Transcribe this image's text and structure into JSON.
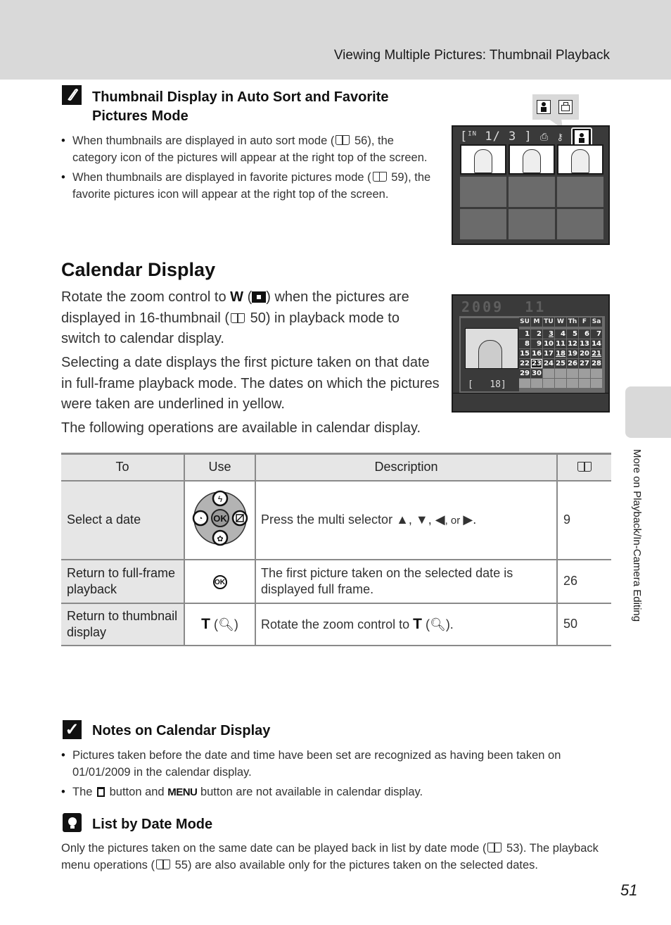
{
  "header": {
    "title": "Viewing Multiple Pictures: Thumbnail Playback"
  },
  "side_tab": {
    "label": "More on Playback/In-Camera Editing"
  },
  "page_number": "51",
  "thumbnail_note": {
    "icon": "pencil-note-icon",
    "title_line1": "Thumbnail Display in Auto Sort and Favorite",
    "title_line2": "Pictures Mode",
    "bullets": [
      {
        "pre": "When thumbnails are displayed in auto sort mode (",
        "ref": "56",
        "post": "), the category icon of the pictures will appear at the right top of the screen."
      },
      {
        "pre": "When thumbnails are displayed in favorite pictures mode (",
        "ref": "59",
        "post": "), the favorite pictures icon will appear at the right top of the screen."
      }
    ]
  },
  "thumb_screen": {
    "memory": "IN",
    "frame_status": "1/ 3",
    "callout_icons": [
      "portrait-category-icon",
      "museum-bag-category-icon"
    ],
    "highlight_icon": "portrait-category-icon",
    "photo_count": 3,
    "empty_count": 6
  },
  "calendar_section": {
    "title": "Calendar Display",
    "para1_pre": "Rotate the zoom control to ",
    "para1_w": "W",
    "para1_mid": ") when the pictures are displayed in 16-thumbnail (",
    "para1_ref": "50",
    "para1_post": ") in playback mode to switch to calendar display.",
    "para2": "Selecting a date displays the first picture taken on that date in full-frame playback mode. The dates on which the pictures were taken are underlined in yellow.",
    "para3": "The following operations are available in calendar display."
  },
  "calendar_screen": {
    "year": "2009",
    "month": "11",
    "weekdays": [
      "SU",
      "M",
      "TU",
      "W",
      "Th",
      "F",
      "Sa"
    ],
    "days": [
      1,
      2,
      3,
      4,
      5,
      6,
      7,
      8,
      9,
      10,
      11,
      12,
      13,
      14,
      15,
      16,
      17,
      18,
      19,
      20,
      21,
      22,
      23,
      24,
      25,
      26,
      27,
      28,
      29,
      30
    ],
    "marked_days": [
      3,
      18,
      21
    ],
    "selected_day": 23,
    "count": "18"
  },
  "table": {
    "headers": {
      "to": "To",
      "use": "Use",
      "description": "Description",
      "ref_icon": "book-icon"
    },
    "rows": [
      {
        "to": "Select a date",
        "use_icon": "multi-selector-icon",
        "desc_pre": "Press the multi selector ",
        "desc_arrows": "▲, ▼, ◀",
        "desc_or": ", or ",
        "desc_last": "▶",
        "desc_end": ".",
        "ref": "9"
      },
      {
        "to": "Return to full-frame playback",
        "use_icon": "ok-button-icon",
        "use_text": "OK",
        "desc": "The first picture taken on the selected date is displayed full frame.",
        "ref": "26"
      },
      {
        "to": "Return to thumbnail display",
        "use_t": "T",
        "use_paren_open": " (",
        "use_paren_close": ")",
        "desc_pre": "Rotate the zoom control to ",
        "desc_t": "T",
        "desc_paren_open": " (",
        "desc_post": ").",
        "ref": "50"
      }
    ]
  },
  "notes": {
    "title": "Notes on Calendar Display",
    "bullet1": "Pictures taken before the date and time have been set are recognized as having been taken on 01/01/2009 in the calendar display.",
    "bullet2_pre": "The ",
    "bullet2_mid": " button and ",
    "bullet2_menu": "MENU",
    "bullet2_post": " button are not available in calendar display."
  },
  "list_by_date": {
    "title": "List by Date Mode",
    "p_pre": "Only the pictures taken on the same date can be played back in list by date mode (",
    "p_ref1": "53",
    "p_mid": "). The playback menu operations (",
    "p_ref2": "55",
    "p_post": ") are also available only for the pictures taken on the selected dates."
  }
}
